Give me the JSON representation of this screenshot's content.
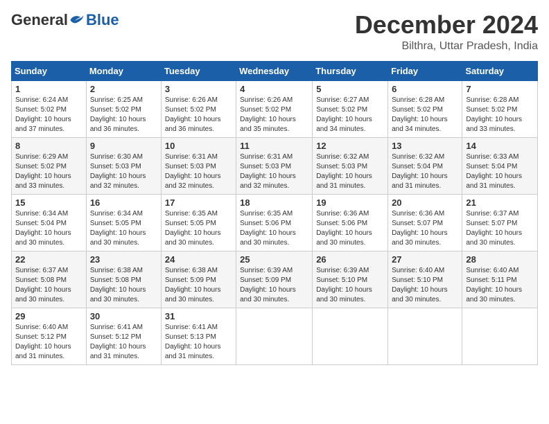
{
  "logo": {
    "general": "General",
    "blue": "Blue"
  },
  "title": {
    "month_year": "December 2024",
    "location": "Bilthra, Uttar Pradesh, India"
  },
  "weekdays": [
    "Sunday",
    "Monday",
    "Tuesday",
    "Wednesday",
    "Thursday",
    "Friday",
    "Saturday"
  ],
  "weeks": [
    [
      {
        "day": "1",
        "sunrise": "6:24 AM",
        "sunset": "5:02 PM",
        "daylight": "10 hours and 37 minutes."
      },
      {
        "day": "2",
        "sunrise": "6:25 AM",
        "sunset": "5:02 PM",
        "daylight": "10 hours and 36 minutes."
      },
      {
        "day": "3",
        "sunrise": "6:26 AM",
        "sunset": "5:02 PM",
        "daylight": "10 hours and 36 minutes."
      },
      {
        "day": "4",
        "sunrise": "6:26 AM",
        "sunset": "5:02 PM",
        "daylight": "10 hours and 35 minutes."
      },
      {
        "day": "5",
        "sunrise": "6:27 AM",
        "sunset": "5:02 PM",
        "daylight": "10 hours and 34 minutes."
      },
      {
        "day": "6",
        "sunrise": "6:28 AM",
        "sunset": "5:02 PM",
        "daylight": "10 hours and 34 minutes."
      },
      {
        "day": "7",
        "sunrise": "6:28 AM",
        "sunset": "5:02 PM",
        "daylight": "10 hours and 33 minutes."
      }
    ],
    [
      {
        "day": "8",
        "sunrise": "6:29 AM",
        "sunset": "5:02 PM",
        "daylight": "10 hours and 33 minutes."
      },
      {
        "day": "9",
        "sunrise": "6:30 AM",
        "sunset": "5:03 PM",
        "daylight": "10 hours and 32 minutes."
      },
      {
        "day": "10",
        "sunrise": "6:31 AM",
        "sunset": "5:03 PM",
        "daylight": "10 hours and 32 minutes."
      },
      {
        "day": "11",
        "sunrise": "6:31 AM",
        "sunset": "5:03 PM",
        "daylight": "10 hours and 32 minutes."
      },
      {
        "day": "12",
        "sunrise": "6:32 AM",
        "sunset": "5:03 PM",
        "daylight": "10 hours and 31 minutes."
      },
      {
        "day": "13",
        "sunrise": "6:32 AM",
        "sunset": "5:04 PM",
        "daylight": "10 hours and 31 minutes."
      },
      {
        "day": "14",
        "sunrise": "6:33 AM",
        "sunset": "5:04 PM",
        "daylight": "10 hours and 31 minutes."
      }
    ],
    [
      {
        "day": "15",
        "sunrise": "6:34 AM",
        "sunset": "5:04 PM",
        "daylight": "10 hours and 30 minutes."
      },
      {
        "day": "16",
        "sunrise": "6:34 AM",
        "sunset": "5:05 PM",
        "daylight": "10 hours and 30 minutes."
      },
      {
        "day": "17",
        "sunrise": "6:35 AM",
        "sunset": "5:05 PM",
        "daylight": "10 hours and 30 minutes."
      },
      {
        "day": "18",
        "sunrise": "6:35 AM",
        "sunset": "5:06 PM",
        "daylight": "10 hours and 30 minutes."
      },
      {
        "day": "19",
        "sunrise": "6:36 AM",
        "sunset": "5:06 PM",
        "daylight": "10 hours and 30 minutes."
      },
      {
        "day": "20",
        "sunrise": "6:36 AM",
        "sunset": "5:07 PM",
        "daylight": "10 hours and 30 minutes."
      },
      {
        "day": "21",
        "sunrise": "6:37 AM",
        "sunset": "5:07 PM",
        "daylight": "10 hours and 30 minutes."
      }
    ],
    [
      {
        "day": "22",
        "sunrise": "6:37 AM",
        "sunset": "5:08 PM",
        "daylight": "10 hours and 30 minutes."
      },
      {
        "day": "23",
        "sunrise": "6:38 AM",
        "sunset": "5:08 PM",
        "daylight": "10 hours and 30 minutes."
      },
      {
        "day": "24",
        "sunrise": "6:38 AM",
        "sunset": "5:09 PM",
        "daylight": "10 hours and 30 minutes."
      },
      {
        "day": "25",
        "sunrise": "6:39 AM",
        "sunset": "5:09 PM",
        "daylight": "10 hours and 30 minutes."
      },
      {
        "day": "26",
        "sunrise": "6:39 AM",
        "sunset": "5:10 PM",
        "daylight": "10 hours and 30 minutes."
      },
      {
        "day": "27",
        "sunrise": "6:40 AM",
        "sunset": "5:10 PM",
        "daylight": "10 hours and 30 minutes."
      },
      {
        "day": "28",
        "sunrise": "6:40 AM",
        "sunset": "5:11 PM",
        "daylight": "10 hours and 30 minutes."
      }
    ],
    [
      {
        "day": "29",
        "sunrise": "6:40 AM",
        "sunset": "5:12 PM",
        "daylight": "10 hours and 31 minutes."
      },
      {
        "day": "30",
        "sunrise": "6:41 AM",
        "sunset": "5:12 PM",
        "daylight": "10 hours and 31 minutes."
      },
      {
        "day": "31",
        "sunrise": "6:41 AM",
        "sunset": "5:13 PM",
        "daylight": "10 hours and 31 minutes."
      },
      null,
      null,
      null,
      null
    ]
  ]
}
